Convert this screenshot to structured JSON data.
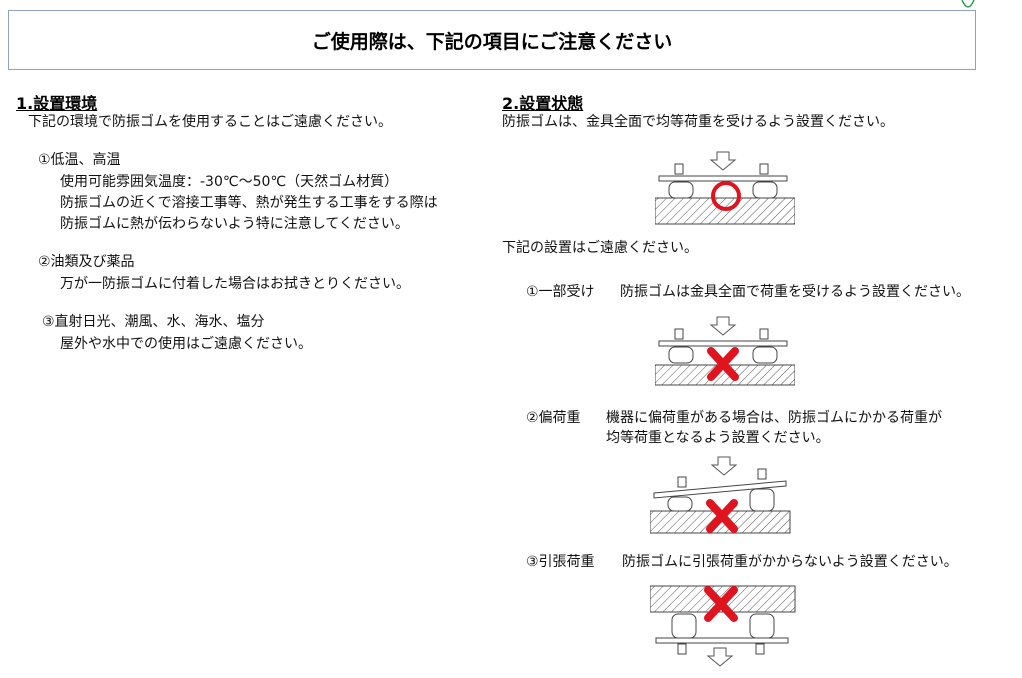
{
  "title": "ご使用際は、下記の項目にご注意ください",
  "section1": {
    "heading": "1.設置環境",
    "intro": "下記の環境で防振ゴムを使用することはご遠慮ください。",
    "items": [
      {
        "label": "①低温、高温",
        "lines": [
          "使用可能雰囲気温度：-30℃〜50℃（天然ゴム材質）",
          "防振ゴムの近くで溶接工事等、熱が発生する工事をする際は",
          "防振ゴムに熱が伝わらないよう特に注意してください。"
        ]
      },
      {
        "label": "②油類及び薬品",
        "lines": [
          "万が一防振ゴムに付着した場合はお拭きとりください。"
        ]
      },
      {
        "label": "③直射日光、潮風、水、海水、塩分",
        "lines": [
          "屋外や水中での使用はご遠慮ください。"
        ]
      }
    ]
  },
  "section2": {
    "heading": "2.設置状態",
    "intro": "防振ゴムは、金具全面で均等荷重を受けるよう設置ください。",
    "avoid": "下記の設置はご遠慮ください。",
    "cases": [
      {
        "label": "①一部受け",
        "desc": [
          "防振ゴムは金具全面で荷重を受けるよう設置ください。"
        ]
      },
      {
        "label": "②偏荷重",
        "desc": [
          "機器に偏荷重がある場合は、防振ゴムにかかる荷重が",
          "均等荷重となるよう設置ください。"
        ]
      },
      {
        "label": "③引張荷重",
        "desc": [
          "防振ゴムに引張荷重がかからないよう設置ください。"
        ]
      }
    ]
  },
  "colors": {
    "ok_mark": "#e0141e",
    "ng_mark": "#e0141e",
    "title_border": "#8fa3b8",
    "corner_mark": "#2e9a4c"
  },
  "icons": {
    "ok": "circle-ok-icon",
    "ng": "cross-ng-icon",
    "load": "arrow-down-icon"
  }
}
